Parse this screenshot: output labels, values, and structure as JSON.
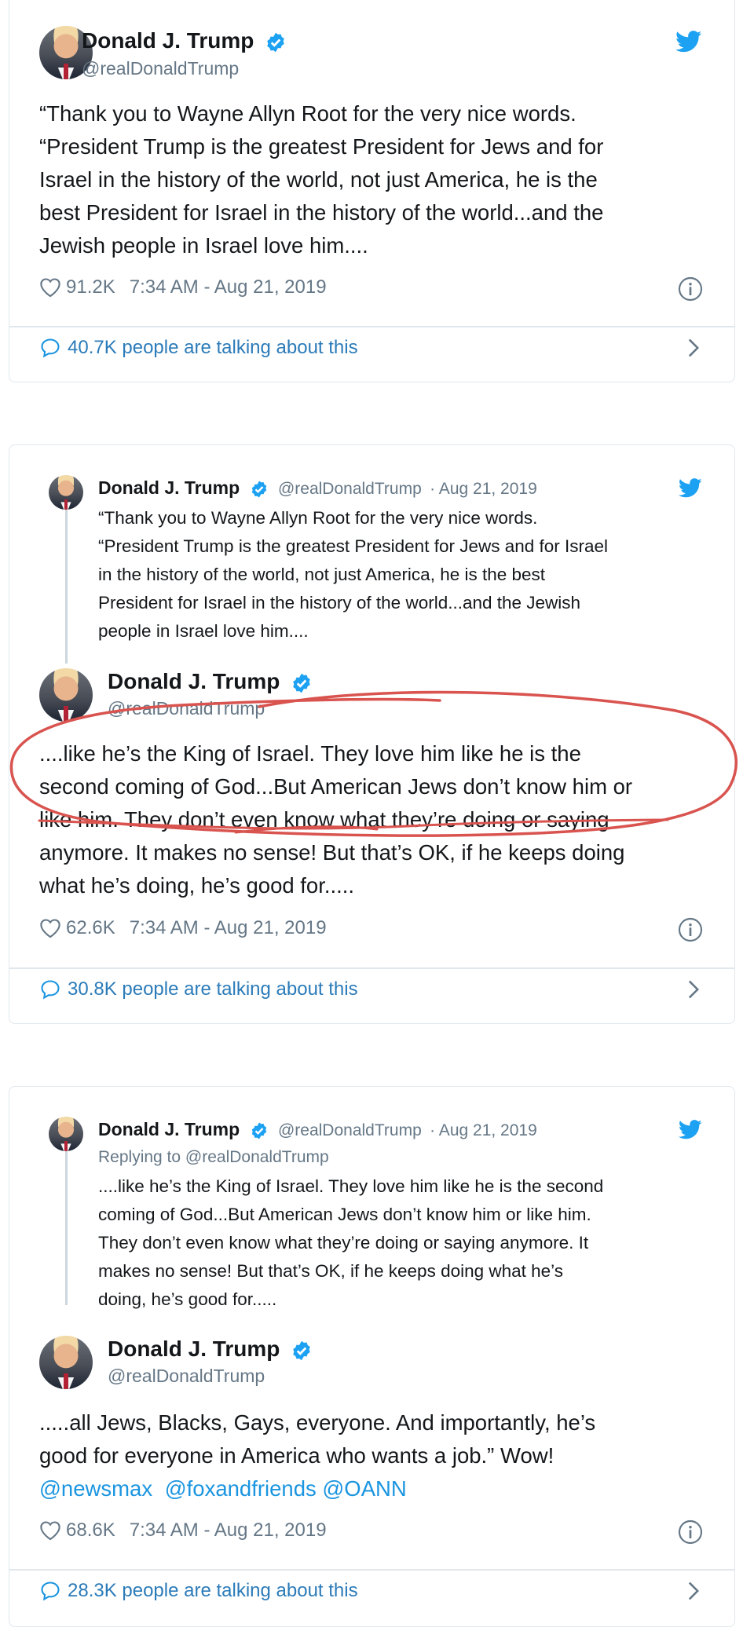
{
  "colors": {
    "accent": "#1da1f2",
    "link": "#1b95e0",
    "muted": "#657786",
    "annotation": "#d9534f"
  },
  "tweets": [
    {
      "author": {
        "name": "Donald J. Trump",
        "handle": "@realDonaldTrump",
        "verified": true,
        "avatar": "profile-photo"
      },
      "text_lines": [
        "“Thank you to Wayne Allyn Root for the very nice words.",
        "“President Trump is the greatest President for Jews and for",
        "Israel in the history of the world, not just America, he is the",
        "best President for Israel in the history of the world...and the",
        "Jewish people in Israel love him...."
      ],
      "likes": "91.2K",
      "timestamp": "7:34 AM - Aug 21, 2019",
      "talking": "40.7K people are talking about this"
    },
    {
      "quoted": {
        "name": "Donald J. Trump",
        "handle": "@realDonaldTrump",
        "date": "· Aug 21, 2019",
        "text_lines": [
          "“Thank you to Wayne Allyn Root for the very nice words.",
          "“President Trump is the greatest President for Jews and for Israel",
          "in the history of the world, not just America, he is the best",
          "President for Israel in the history of the world...and the Jewish",
          "people in Israel love him...."
        ]
      },
      "author": {
        "name": "Donald J. Trump",
        "handle": "@realDonaldTrump",
        "verified": true,
        "avatar": "profile-photo"
      },
      "text_lines": [
        "....like he’s the King of Israel. They love him like he is the",
        "second coming of God...But American Jews don’t know him or",
        "like him. They don’t even know what they’re doing or saying",
        "anymore. It makes no sense! But that’s OK, if he keeps doing",
        "what he’s doing, he’s good for....."
      ],
      "likes": "62.6K",
      "timestamp": "7:34 AM - Aug 21, 2019",
      "talking": "30.8K people are talking about this"
    },
    {
      "quoted": {
        "name": "Donald J. Trump",
        "handle": "@realDonaldTrump",
        "date": "· Aug 21, 2019",
        "replying": "Replying to @realDonaldTrump",
        "text_lines": [
          "....like he’s the King of Israel. They love him like he is the second",
          "coming of God...But American Jews don’t know him or like him.",
          "They don’t even know what they’re doing or saying anymore. It",
          "makes no sense! But that’s OK, if he keeps doing what he’s",
          "doing, he’s good for....."
        ]
      },
      "author": {
        "name": "Donald J. Trump",
        "handle": "@realDonaldTrump",
        "verified": true,
        "avatar": "profile-photo"
      },
      "text_lines": [
        ".....all Jews, Blacks, Gays, everyone. And importantly, he’s",
        "good for everyone in America who wants a job.” Wow!"
      ],
      "mentions": [
        "@newsmax",
        "@foxandfriends",
        "@OANN"
      ],
      "likes": "68.6K",
      "timestamp": "7:34 AM - Aug 21, 2019",
      "talking": "28.3K people are talking about this"
    }
  ]
}
